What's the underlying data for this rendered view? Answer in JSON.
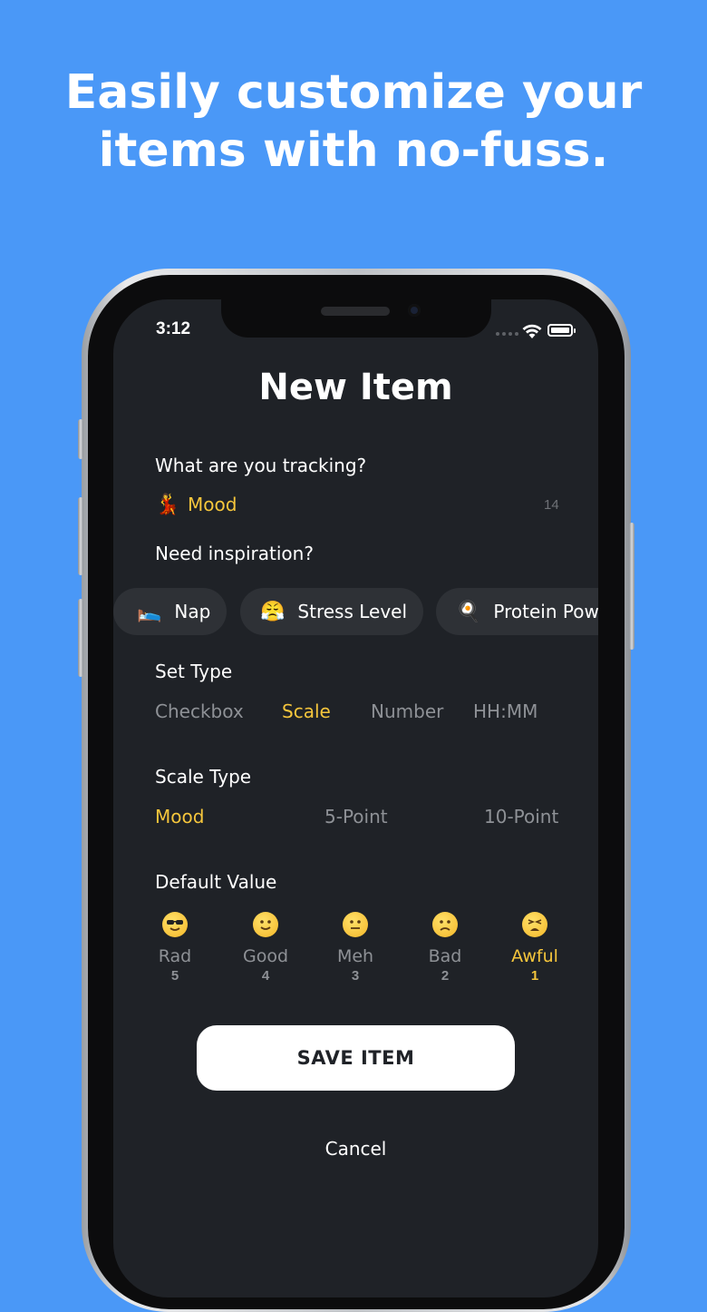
{
  "headline": {
    "line1": "Easily customize your",
    "line2": "items with no-fuss."
  },
  "status_bar": {
    "time": "3:12"
  },
  "screen": {
    "title": "New Item",
    "tracking": {
      "label": "What are you tracking?",
      "emoji": "💃",
      "value": "Mood",
      "char_count": "14"
    },
    "inspiration": {
      "label": "Need inspiration?",
      "chips": [
        {
          "emoji": "🛌",
          "label": "Nap"
        },
        {
          "emoji": "😤",
          "label": "Stress Level"
        },
        {
          "emoji": "🍳",
          "label": "Protein Pow"
        }
      ]
    },
    "set_type": {
      "label": "Set Type",
      "options": [
        "Checkbox",
        "Scale",
        "Number",
        "HH:MM"
      ],
      "selected": "Scale"
    },
    "scale_type": {
      "label": "Scale Type",
      "options": [
        "Mood",
        "5-Point",
        "10-Point"
      ],
      "selected": "Mood"
    },
    "default_value": {
      "label": "Default Value",
      "moods": [
        {
          "icon": "cool-face-icon",
          "label": "Rad",
          "value": "5"
        },
        {
          "icon": "slight-smile-icon",
          "label": "Good",
          "value": "4"
        },
        {
          "icon": "neutral-face-icon",
          "label": "Meh",
          "value": "3"
        },
        {
          "icon": "frown-face-icon",
          "label": "Bad",
          "value": "2"
        },
        {
          "icon": "tired-face-icon",
          "label": "Awful",
          "value": "1"
        }
      ],
      "selected": "Awful"
    },
    "save_label": "SAVE ITEM",
    "cancel_label": "Cancel"
  },
  "colors": {
    "background": "#4a98f7",
    "screen": "#1f2227",
    "accent": "#f6c63c",
    "muted": "#8e9196"
  }
}
